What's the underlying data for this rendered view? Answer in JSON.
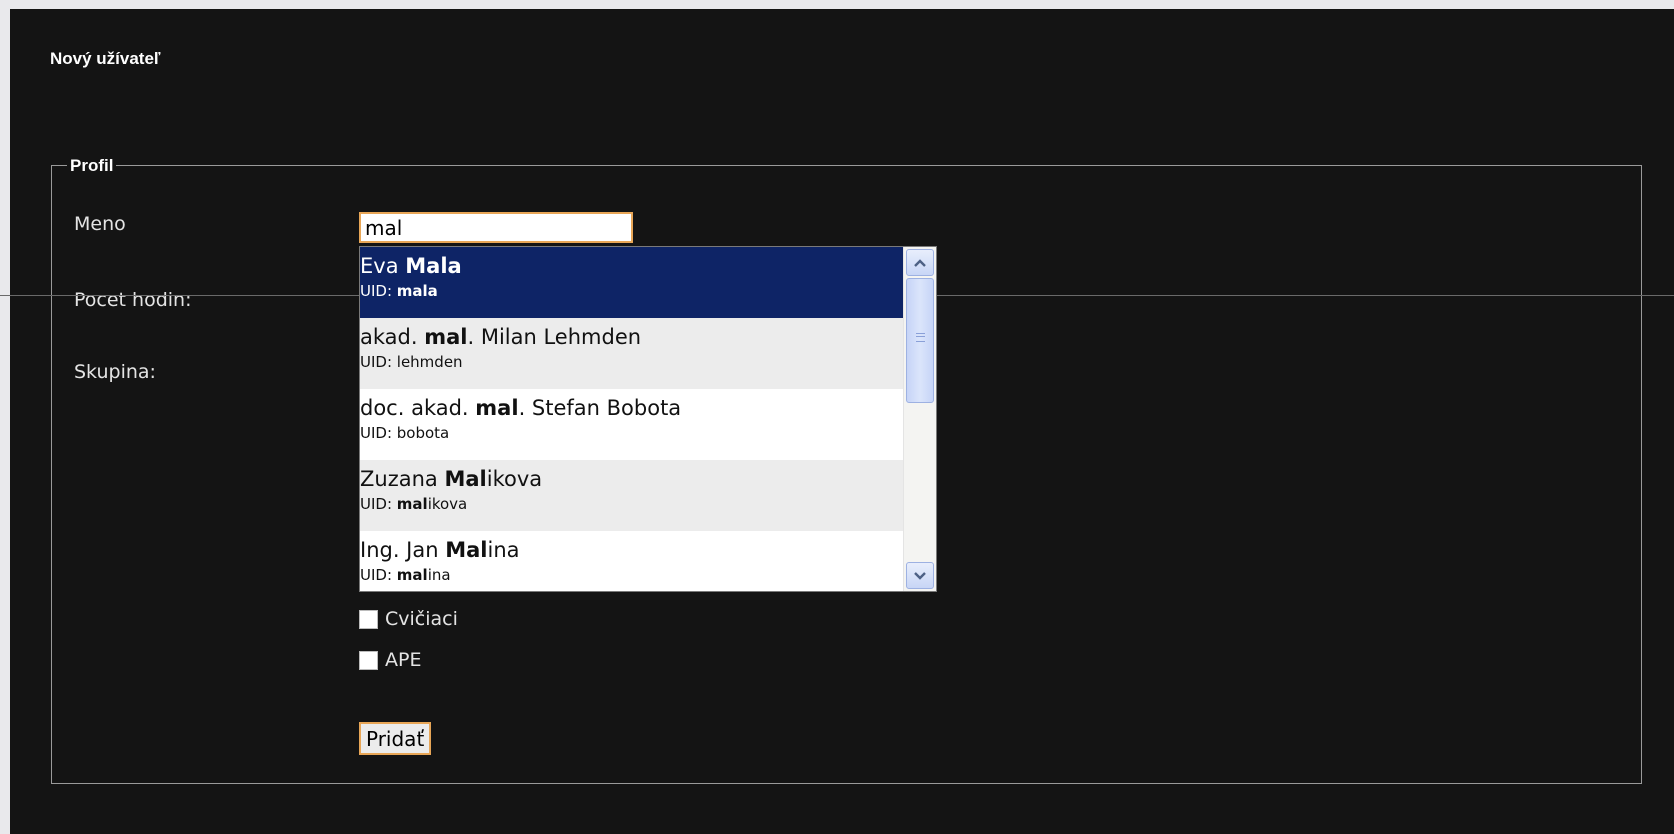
{
  "page": {
    "title": "Nový užívateľ"
  },
  "form": {
    "legend": "Profil",
    "labels": {
      "meno": "Meno",
      "pocet_hodin": "Pocet hodin:",
      "skupina": "Skupina:"
    },
    "meno_value": "mal",
    "checkboxes": [
      {
        "label": "Cvičiaci",
        "checked": false
      },
      {
        "label": "APE",
        "checked": false
      }
    ],
    "submit_label": "Pridať"
  },
  "autocomplete": {
    "query": "mal",
    "items": [
      {
        "name_pre": "Eva ",
        "name_match": "Mala",
        "name_post": "",
        "uid_prefix": "UID: ",
        "uid_match": "mala",
        "uid_post": "",
        "state": "selected"
      },
      {
        "name_pre": "akad. ",
        "name_match": "mal",
        "name_post": ". Milan Lehmden",
        "uid_prefix": "UID: ",
        "uid_match": "",
        "uid_post": "lehmden",
        "state": "alt"
      },
      {
        "name_pre": "doc. akad. ",
        "name_match": "mal",
        "name_post": ". Stefan Bobota",
        "uid_prefix": "UID: ",
        "uid_match": "",
        "uid_post": "bobota",
        "state": "plain"
      },
      {
        "name_pre": "Zuzana ",
        "name_match": "Mal",
        "name_post": "ikova",
        "uid_prefix": "UID: ",
        "uid_match": "mal",
        "uid_post": "ikova",
        "state": "alt"
      },
      {
        "name_pre": "Ing. Jan ",
        "name_match": "Mal",
        "name_post": "ina",
        "uid_prefix": "UID: ",
        "uid_match": "mal",
        "uid_post": "ina",
        "state": "plain"
      }
    ]
  },
  "icons": {
    "scroll_up": "chevron-up-icon",
    "scroll_down": "chevron-down-icon"
  },
  "colors": {
    "background": "#141414",
    "selected_item": "#0e2466",
    "input_border": "#e8a657"
  }
}
